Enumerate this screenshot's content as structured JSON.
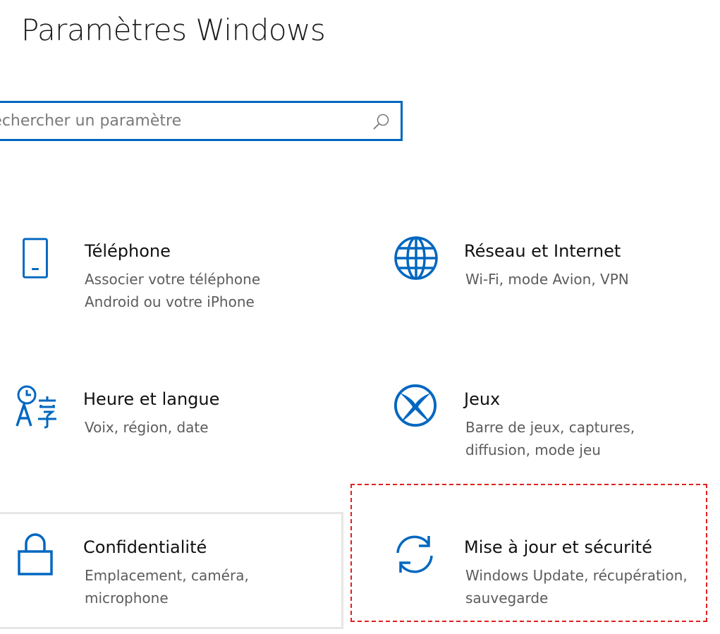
{
  "window": {
    "title": "Paramètres Windows"
  },
  "search": {
    "placeholder": "Rechercher un paramètre",
    "icon": "search-icon"
  },
  "accent_color": "#0067c0",
  "tiles": [
    {
      "label": "Téléphone",
      "description": [
        "Associer votre téléphone",
        "Android ou votre iPhone"
      ],
      "icon": "phone-icon"
    },
    {
      "label": "Réseau et Internet",
      "description": [
        "Wi-Fi, mode Avion, VPN"
      ],
      "icon": "globe-icon"
    },
    {
      "label": "Heure et langue",
      "description": [
        "Voix, région, date"
      ],
      "icon": "time-language-icon"
    },
    {
      "label": "Jeux",
      "description": [
        "Barre de jeux, captures,",
        "diffusion, mode jeu"
      ],
      "icon": "xbox-icon"
    },
    {
      "label": "Confidentialité",
      "description": [
        "Emplacement, caméra,",
        "microphone"
      ],
      "icon": "lock-icon"
    },
    {
      "label": "Mise à jour et sécurité",
      "description": [
        "Windows Update, récupération,",
        "sauvegarde"
      ],
      "icon": "update-sync-icon"
    }
  ]
}
